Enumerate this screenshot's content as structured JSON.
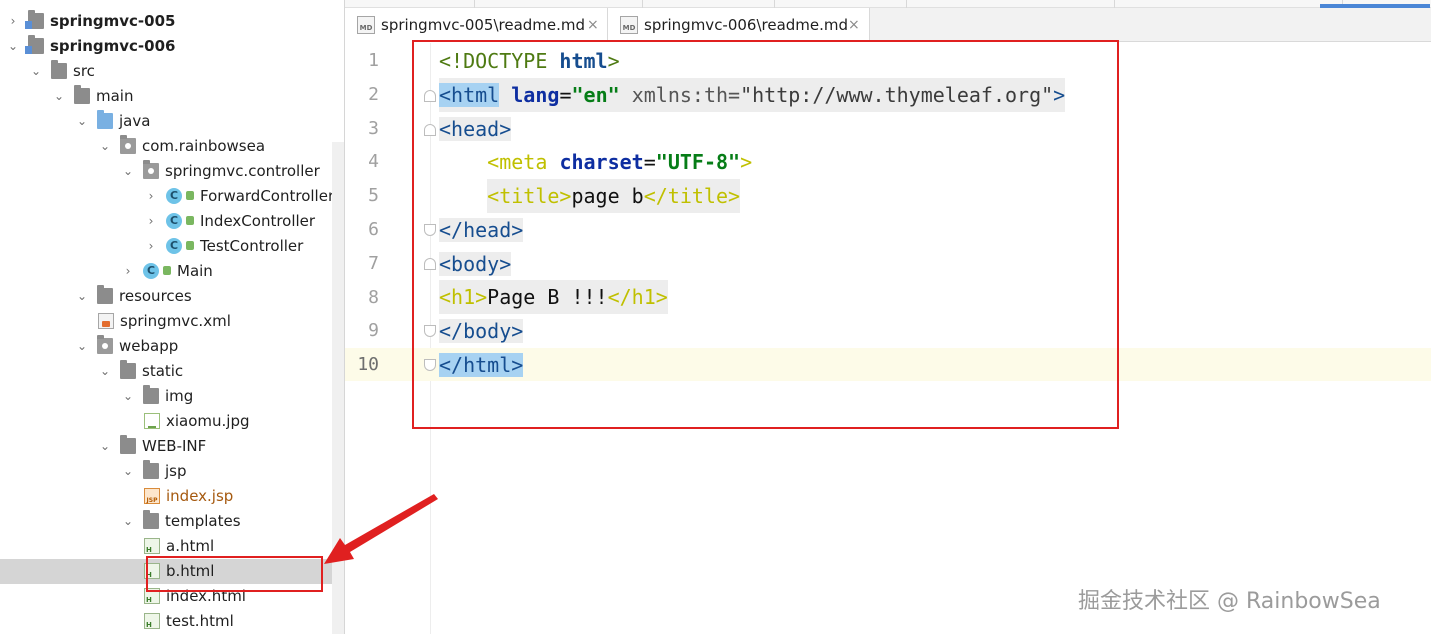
{
  "project_tree": {
    "rows": [
      {
        "label": "springmvc-005",
        "arrow": "›",
        "icon": "module",
        "bold": true
      },
      {
        "label": "springmvc-006",
        "arrow": "⌄",
        "icon": "module",
        "bold": true
      },
      {
        "label": "src",
        "arrow": "⌄",
        "icon": "folder"
      },
      {
        "label": "main",
        "arrow": "⌄",
        "icon": "folder"
      },
      {
        "label": "java",
        "arrow": "⌄",
        "icon": "folder-blue"
      },
      {
        "label": "com.rainbowsea",
        "arrow": "⌄",
        "icon": "package"
      },
      {
        "label": "springmvc.controller",
        "arrow": "⌄",
        "icon": "package"
      },
      {
        "label": "ForwardController",
        "arrow": "›",
        "icon": "class"
      },
      {
        "label": "IndexController",
        "arrow": "›",
        "icon": "class"
      },
      {
        "label": "TestController",
        "arrow": "›",
        "icon": "class"
      },
      {
        "label": "Main",
        "arrow": "›",
        "icon": "class-main"
      },
      {
        "label": "resources",
        "arrow": "⌄",
        "icon": "folder-res"
      },
      {
        "label": "springmvc.xml",
        "arrow": "",
        "icon": "xml"
      },
      {
        "label": "webapp",
        "arrow": "⌄",
        "icon": "folder-web"
      },
      {
        "label": "static",
        "arrow": "⌄",
        "icon": "folder"
      },
      {
        "label": "img",
        "arrow": "⌄",
        "icon": "folder"
      },
      {
        "label": "xiaomu.jpg",
        "arrow": "",
        "icon": "image"
      },
      {
        "label": "WEB-INF",
        "arrow": "⌄",
        "icon": "folder"
      },
      {
        "label": "jsp",
        "arrow": "⌄",
        "icon": "folder"
      },
      {
        "label": "index.jsp",
        "arrow": "",
        "icon": "jsp"
      },
      {
        "label": "templates",
        "arrow": "⌄",
        "icon": "folder"
      },
      {
        "label": "a.html",
        "arrow": "",
        "icon": "html"
      },
      {
        "label": "b.html",
        "arrow": "",
        "icon": "html",
        "selected": true
      },
      {
        "label": "index.html",
        "arrow": "",
        "icon": "html"
      },
      {
        "label": "test.html",
        "arrow": "",
        "icon": "html"
      }
    ]
  },
  "tabs": [
    {
      "label": "springmvc-005\\readme.md",
      "icon_text": "MD",
      "close": "×"
    },
    {
      "label": "springmvc-006\\readme.md",
      "icon_text": "MD",
      "close": "×"
    }
  ],
  "editor": {
    "line_numbers": [
      "1",
      "2",
      "3",
      "4",
      "5",
      "6",
      "7",
      "8",
      "9",
      "10"
    ],
    "current_line": "10",
    "code": {
      "l1": {
        "open": "<!DOCTYPE ",
        "kw": "html",
        "close": ">"
      },
      "l2": {
        "tag": "<html",
        "attr1": "lang",
        "eq1": "=",
        "val1": "\"en\"",
        "attr2": " xmlns:th",
        "eq2": "=",
        "val2": "\"http://www.thymeleaf.org\"",
        "close": ">"
      },
      "l3": {
        "tag": "<head>"
      },
      "l4": {
        "indent": "    ",
        "tag": "<meta",
        "attr": "charset",
        "eq": "=",
        "val": "\"UTF-8\"",
        "close": ">"
      },
      "l5": {
        "indent": "    ",
        "open": "<title>",
        "text": "page b",
        "close": "</title>"
      },
      "l6": {
        "tag": "</head>"
      },
      "l7": {
        "tag": "<body>"
      },
      "l8": {
        "open": "<h1>",
        "text": "Page B !!!",
        "close": "</h1>"
      },
      "l9": {
        "tag": "</body>"
      },
      "l10": {
        "tag": "</html>"
      }
    }
  },
  "watermark": "掘金技术社区 @ RainbowSea",
  "colors": {
    "annotation_red": "#e02020",
    "selection": "#d5d5d5",
    "current_line": "#fdfbe8",
    "tag_blue": "#164d8f",
    "string_green": "#067d17"
  }
}
